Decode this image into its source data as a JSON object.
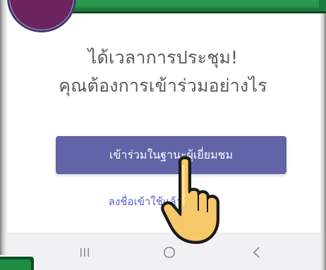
{
  "prompt": {
    "line1": "ได้เวลาการประชุม!",
    "line2": "คุณต้องการเข้าร่วมอย่างไร"
  },
  "actions": {
    "join_as_guest_label": "เข้าร่วมในฐานะผู้เยี่ยมชม",
    "sign_in_label": "ลงชื่อเข้าใช้แล้วเข้าร่วม"
  },
  "system_nav": {
    "recent_apps": "recent-apps-icon",
    "home": "home-icon",
    "back": "back-icon"
  },
  "colors": {
    "primary_button": "#6264a7",
    "link": "#5b5fc7",
    "text": "#5a5a5a",
    "nav_background": "#f1f1f3",
    "accent_green": "#2a8f4d",
    "accent_purple": "#6b245e"
  }
}
